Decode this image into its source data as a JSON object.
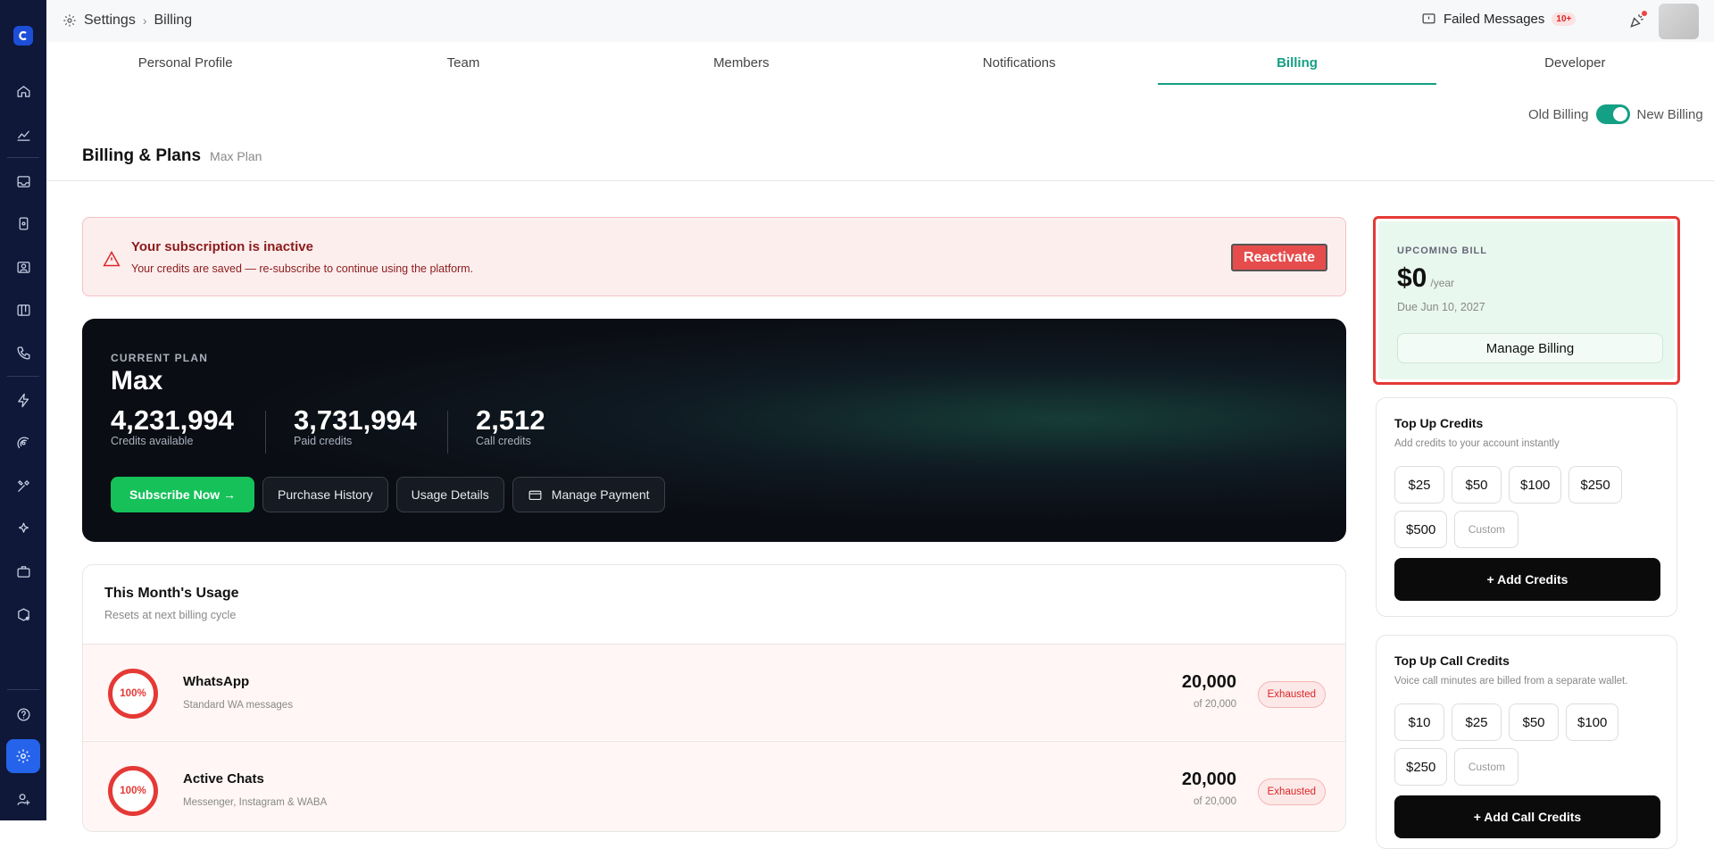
{
  "breadcrumb": {
    "root": "Settings",
    "current": "Billing"
  },
  "topbar": {
    "failed_label": "Failed Messages",
    "failed_badge": "10+"
  },
  "tabs": [
    {
      "label": "Personal Profile"
    },
    {
      "label": "Team"
    },
    {
      "label": "Members"
    },
    {
      "label": "Notifications"
    },
    {
      "label": "Billing"
    },
    {
      "label": "Developer"
    }
  ],
  "toggle": {
    "left_label": "Old Billing",
    "right_label": "New Billing"
  },
  "page": {
    "title": "Billing & Plans",
    "subtitle": "Max Plan"
  },
  "alert": {
    "title": "Your subscription is inactive",
    "text": "Your credits are saved — re-subscribe to continue using the platform.",
    "button": "Reactivate"
  },
  "plan": {
    "label": "CURRENT PLAN",
    "name": "Max",
    "stats": [
      {
        "value": "4,231,994",
        "label": "Credits available"
      },
      {
        "value": "3,731,994",
        "label": "Paid credits"
      },
      {
        "value": "2,512",
        "label": "Call credits"
      }
    ],
    "buttons": {
      "subscribe": "Subscribe Now →",
      "history": "Purchase History",
      "usage": "Usage Details",
      "payment": "Manage Payment"
    }
  },
  "usage": {
    "title": "This Month's Usage",
    "subtitle": "Resets at next billing cycle",
    "rows": [
      {
        "percent": "100%",
        "name": "WhatsApp",
        "desc": "Standard WA messages",
        "used": "20,000",
        "of": "of 20,000",
        "status": "Exhausted"
      },
      {
        "percent": "100%",
        "name": "Active Chats",
        "desc": "Messenger, Instagram & WABA",
        "used": "20,000",
        "of": "of 20,000",
        "status": "Exhausted"
      }
    ]
  },
  "bill": {
    "label": "UPCOMING BILL",
    "amount": "$0",
    "period": "/year",
    "due": "Due Jun 10, 2027",
    "button": "Manage Billing"
  },
  "topup": {
    "title": "Top Up Credits",
    "subtitle": "Add credits to your account instantly",
    "amounts": [
      "$25",
      "$50",
      "$100",
      "$250",
      "$500"
    ],
    "custom": "Custom",
    "button": "+ Add Credits"
  },
  "topup_call": {
    "title": "Top Up Call Credits",
    "subtitle": "Voice call minutes are billed from a separate wallet.",
    "amounts": [
      "$10",
      "$25",
      "$50",
      "$100",
      "$250"
    ],
    "custom": "Custom",
    "button": "+ Add Call Credits"
  },
  "colors": {
    "accent": "#14a085",
    "danger": "#e53935",
    "sidebar": "#0f1838",
    "success": "#16c15a"
  }
}
